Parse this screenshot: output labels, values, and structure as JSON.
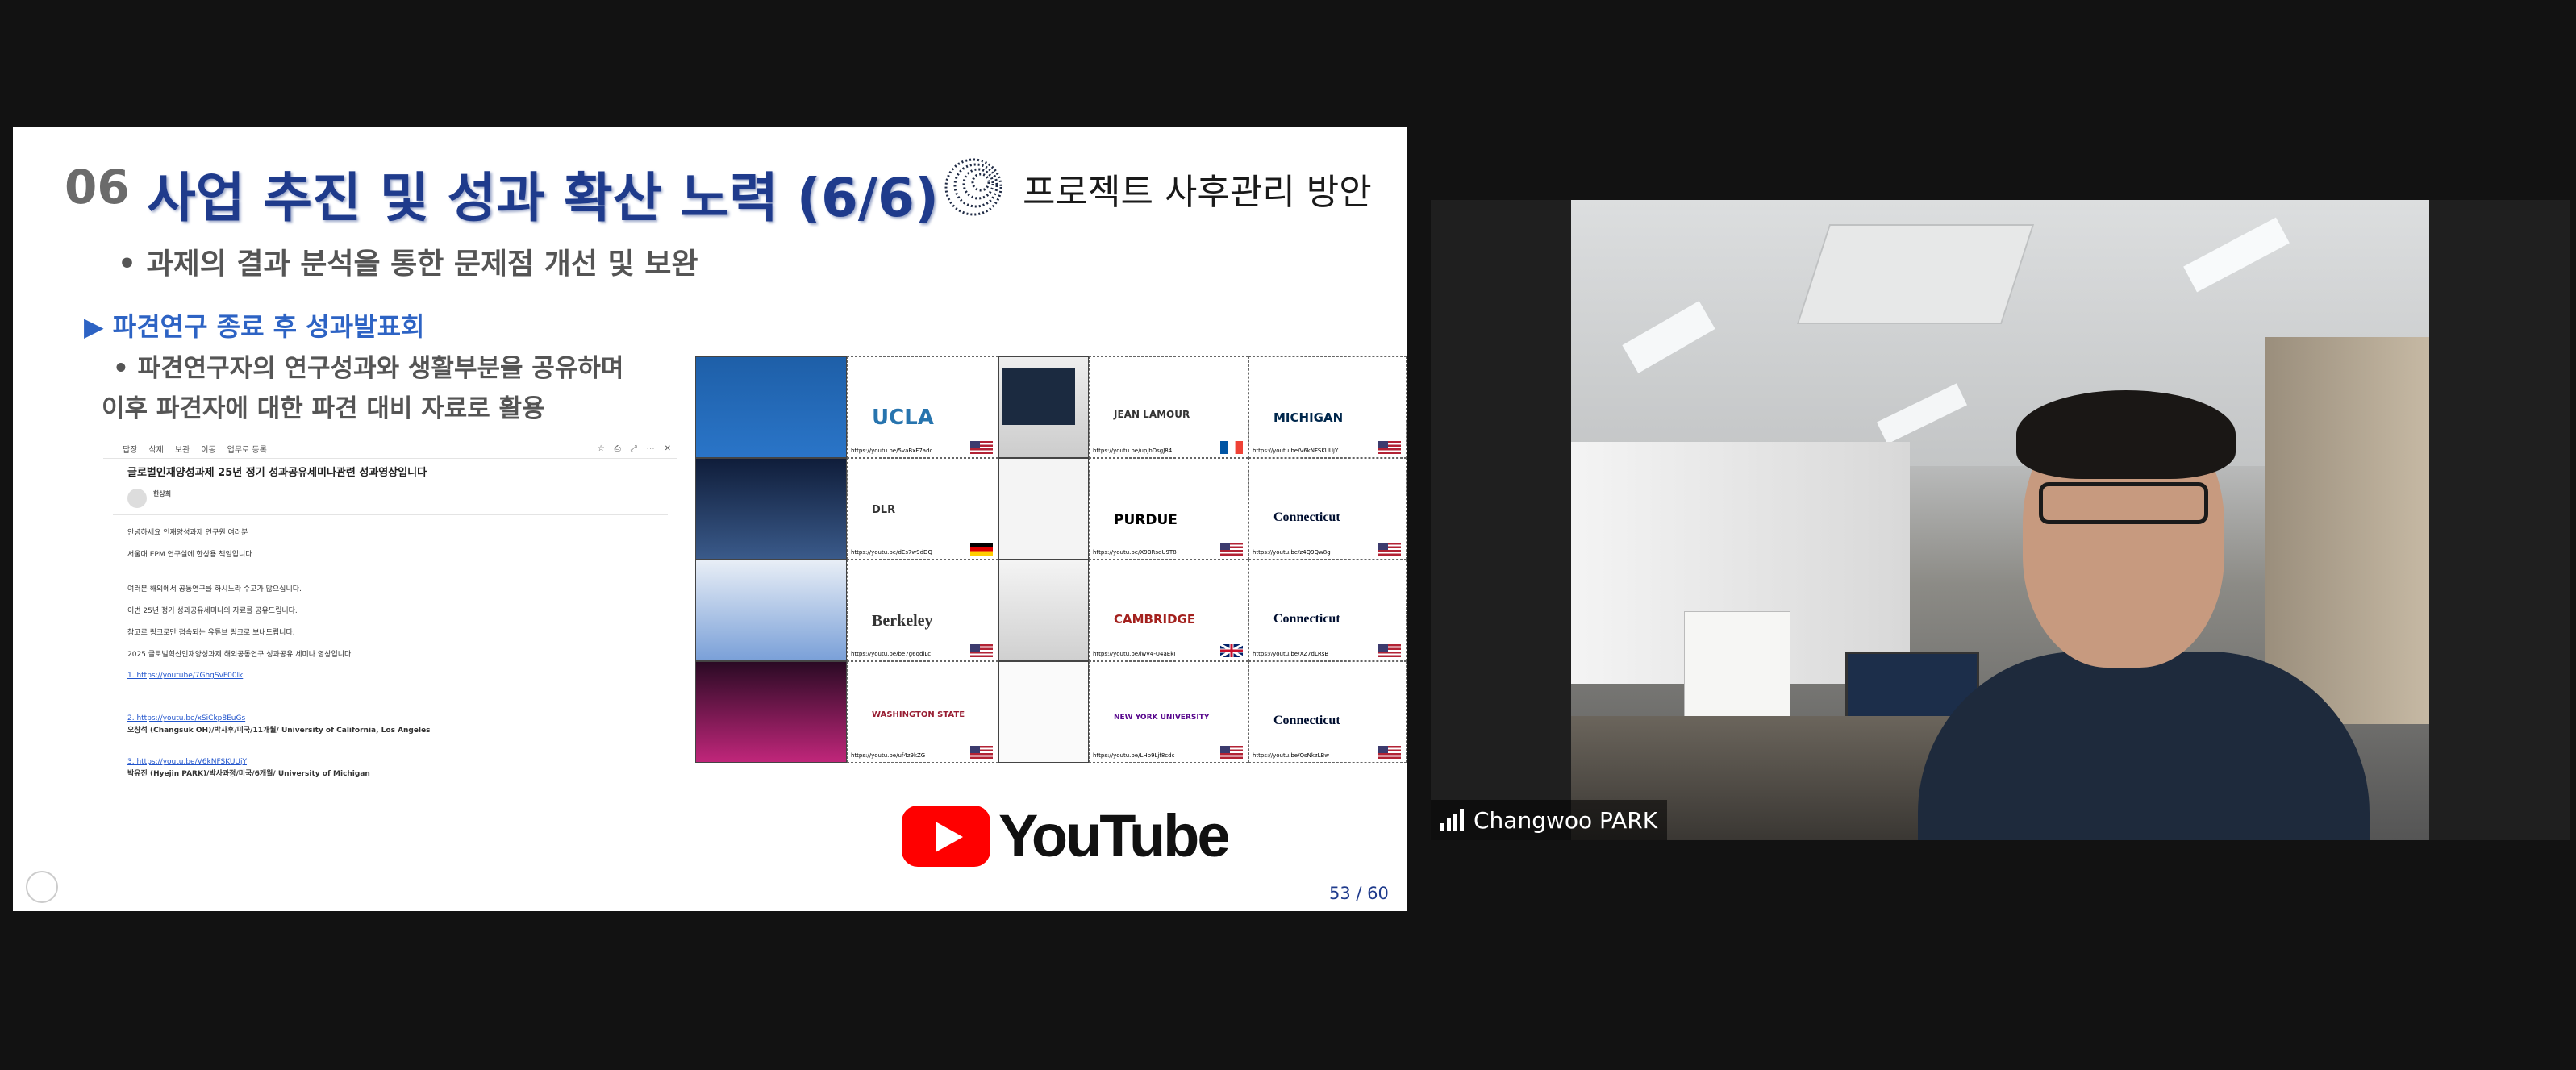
{
  "slide": {
    "number": "06",
    "title": "사업 추진 및 성과 확산 노력 (6/6)",
    "subtitle": "프로젝트 사후관리 방안",
    "bullet1": "• 과제의 결과 분석을 통한 문제점 개선 및 보완",
    "section": "▶ 파견연구 종료 후 성과발표회",
    "bullet2_line1": "•  파견연구자의 연구성과와 생활부분을 공유하며",
    "bullet2_line2": "이후 파견자에 대한 파견 대비 자료로 활용",
    "youtube_label": "YouTube",
    "page_number": "53 / 60"
  },
  "email": {
    "toolbar": [
      "답장",
      "삭제",
      "보관",
      "이동",
      "업무로 등록"
    ],
    "subject": "글로벌인재양성과제 25년 정기 성과공유세미나관련 성과영상입니다",
    "sender": "한상희",
    "body": {
      "greeting": "안녕하세요 인재양성과제 연구원 여러분",
      "line2": "서울대 EPM 연구실에 한상용 책임입니다",
      "line3": "여러분 해외에서 공동연구를 하시느라 수고가 많으십니다.",
      "line4": "이번 25년 정기 성과공유세미나의 자료를 공유드립니다.",
      "line5": "참고로 링크로만 접속되는 유튜브 링크로 보내드립니다.",
      "line6": "2025 글로벌혁신인재양성과제 해외공동연구 성과공유 세미나 영상입니다",
      "item1_link": "1. https://youtube/7GhgSvF00lk",
      "item2_link": "2. https://youtu.be/xSiCkp8EuGs",
      "item2_name": "오창석 (Changsuk OH)/박사후/미국/11개월/ University of California, Los Angeles",
      "item3_link": "3. https://youtu.be/V6kNFSKUUjY",
      "item3_name": "박유진 (Hyejin PARK)/박사과정/미국/6개월/ University of Michigan"
    }
  },
  "collage": {
    "cards": [
      {
        "inst": "UCLA",
        "url": "https://youtu.be/5vaBxF7adc"
      },
      {
        "inst": "DLR",
        "url": "https://youtu.be/dEs7w9dDQ"
      },
      {
        "inst": "Berkeley",
        "url": "https://youtu.be/be7g6qdlLc"
      },
      {
        "inst": "WASHINGTON STATE",
        "url": "https://youtu.be/uf4z9kZG"
      },
      {
        "inst": "JEAN LAMOUR",
        "url": "https://youtu.be/upjbDsgJ84"
      },
      {
        "inst": "PURDUE",
        "url": "https://youtu.be/X9BRseU9T8"
      },
      {
        "inst": "CAMBRIDGE",
        "url": "https://youtu.be/lwV4-U4aEkI"
      },
      {
        "inst": "NEW YORK UNIVERSITY",
        "url": "https://youtu.be/LHp9Ljf8cdc"
      },
      {
        "inst": "MICHIGAN",
        "url": "https://youtu.be/V6kNFSKUUjY"
      },
      {
        "inst": "Connecticut",
        "url": "https://youtu.be/z4Q9Qw8g"
      },
      {
        "inst": "Connecticut",
        "url": "https://youtu.be/XZ7dLRsB"
      },
      {
        "inst": "Connecticut",
        "url": "https://youtu.be/QsNkzLBw"
      }
    ]
  },
  "participant": {
    "name": "Changwoo PARK"
  },
  "colors": {
    "title": "#1f3b8c",
    "section": "#2d63c4",
    "youtube_red": "#ff0000",
    "background": "#121212"
  }
}
